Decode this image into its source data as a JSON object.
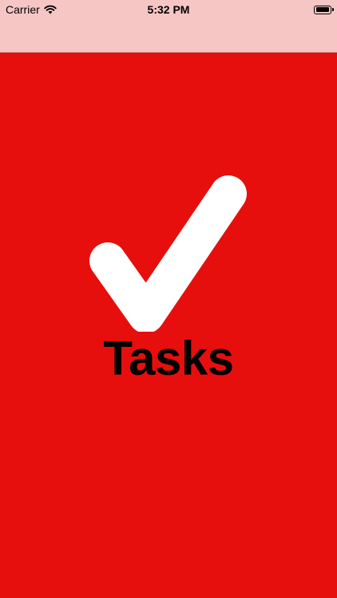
{
  "status_bar": {
    "carrier": "Carrier",
    "time": "5:32 PM",
    "battery_level": 0.95
  },
  "splash": {
    "app_name": "Tasks",
    "logo_icon": "checkmark-icon"
  },
  "colors": {
    "nav_bar": "#f6c6c5",
    "splash_background": "#e60f0d",
    "checkmark": "#ffffff",
    "title": "#000000"
  }
}
